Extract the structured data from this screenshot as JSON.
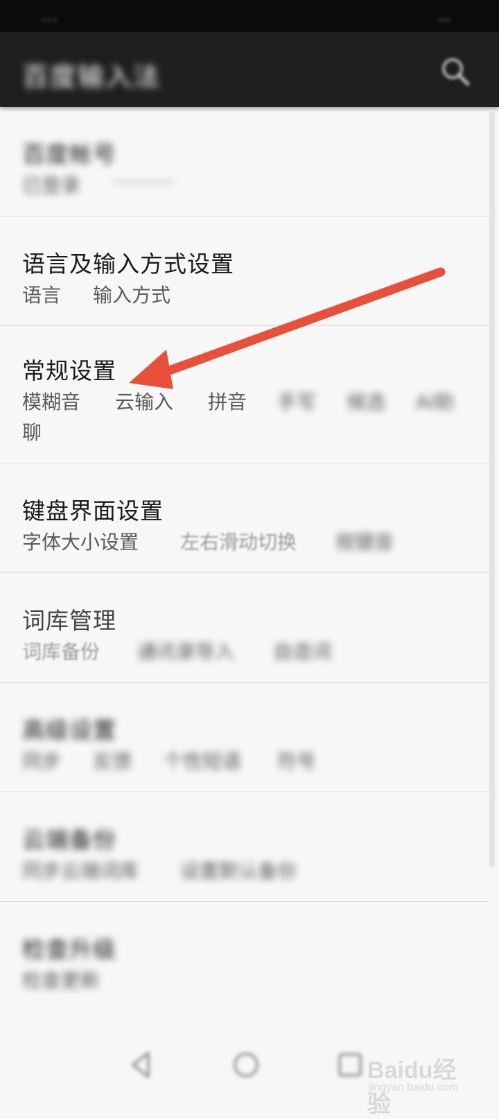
{
  "status_bar": {
    "left": "...",
    "right": "..."
  },
  "app_bar": {
    "title": "百度输入法",
    "search_icon": "search-icon"
  },
  "settings": [
    {
      "title": "百度帐号",
      "subs": [
        "已登录",
        "··········"
      ]
    },
    {
      "title": "语言及输入方式设置",
      "subs": [
        "语言",
        "输入方式"
      ]
    },
    {
      "title": "常规设置",
      "subs": [
        "模糊音",
        "云输入",
        "拼音",
        "手写",
        "候选",
        "AI助",
        "聊"
      ]
    },
    {
      "title": "键盘界面设置",
      "subs": [
        "字体大小设置",
        "左右滑动切换",
        "按键音"
      ]
    },
    {
      "title": "词库管理",
      "subs": [
        "词库备份",
        "通讯录导入",
        "自造词"
      ]
    },
    {
      "title": "高级设置",
      "subs": [
        "同步",
        "反馈",
        "个性短语",
        "符号"
      ]
    },
    {
      "title": "云端备份",
      "subs": [
        "同步云端词库",
        "设置默认备份"
      ]
    },
    {
      "title": "检查升级",
      "subs": [
        "检查更新"
      ]
    }
  ],
  "nav": {
    "back_icon": "back-icon",
    "home_icon": "home-icon",
    "recents_icon": "recents-icon"
  },
  "annotation": {
    "arrow_color": "#e8503a",
    "target": "常规设置"
  },
  "watermark": {
    "main": "Baidu经验",
    "sub": "jingyan.baidu.com"
  }
}
